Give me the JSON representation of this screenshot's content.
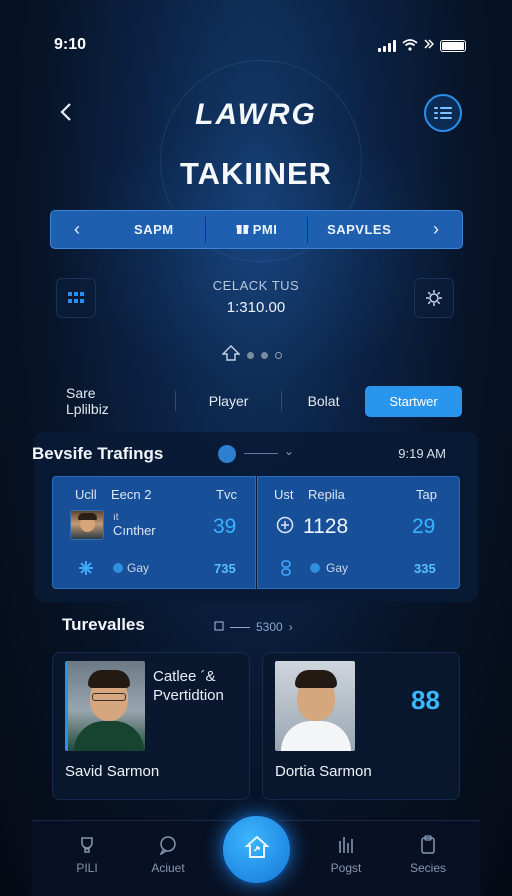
{
  "status_bar": {
    "time": "9:10"
  },
  "header": {
    "logo": "LAWRG",
    "title": "TAKIINER"
  },
  "segments": {
    "items": [
      "SAPM",
      "PMI",
      "SAPVLES"
    ]
  },
  "summary": {
    "label": "CELACK TUS",
    "value": "1:310.00"
  },
  "tabs": {
    "items": [
      "Sare Lplilbiz",
      "Player",
      "Bolat",
      "Startwer"
    ],
    "active_index": 3
  },
  "rankings_panel": {
    "title": "Bevsife Trafings",
    "time": "9:19 AM",
    "left": {
      "col1": "Ucll",
      "col2": "Eecn 2",
      "col3": "Tvc",
      "player_line1": "ıt",
      "player_line2": "Cınther",
      "score": "39",
      "tag": "Gay",
      "value": "735"
    },
    "right": {
      "col1": "Ust",
      "col2": "Repila",
      "col3": "Tap",
      "primary": "1128",
      "score": "29",
      "tag": "Gay",
      "value": "335"
    }
  },
  "featured": {
    "title": "Turevalles",
    "link": "5300",
    "cards": [
      {
        "name": "Savid Sarmon",
        "desc_line1": "Catlee ´&",
        "desc_line2": "Pvertidtion"
      },
      {
        "name": "Dortia Sarmon",
        "score": "88"
      }
    ]
  },
  "bottom_nav": {
    "items": [
      "PILI",
      "Aciuet",
      "Pogst",
      "Secies"
    ]
  },
  "colors": {
    "accent": "#2a95ec",
    "score_blue": "#39b4ff",
    "card_blue": "#174f98"
  }
}
